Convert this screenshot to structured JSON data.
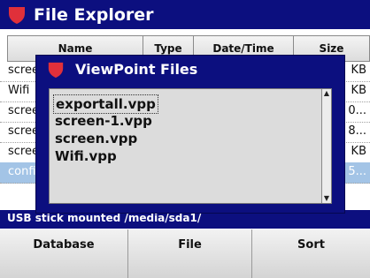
{
  "app": {
    "title": "File Explorer"
  },
  "table": {
    "headers": {
      "name": "Name",
      "type": "Type",
      "date": "Date/Time",
      "size": "Size"
    },
    "rows": [
      {
        "name": "scree",
        "size": "KB"
      },
      {
        "name": "Wifi",
        "size": "KB"
      },
      {
        "name": "scree",
        "size": "0..."
      },
      {
        "name": "scree",
        "size": "8..."
      },
      {
        "name": "scree",
        "size": "KB"
      },
      {
        "name": "confi",
        "size": "5..."
      }
    ]
  },
  "dialog": {
    "title": "ViewPoint Files",
    "files": [
      "exportall.vpp",
      "screen-1.vpp",
      "screen.vpp",
      "Wifi.vpp"
    ],
    "selected_index": 0
  },
  "status": {
    "text": "USB stick mounted /media/sda1/"
  },
  "tabs": {
    "database": "Database",
    "file": "File",
    "sort": "Sort"
  },
  "colors": {
    "titlebar": "#0c0f7f",
    "logo": "#e0303a",
    "selected_row": "#a3c4e6"
  }
}
